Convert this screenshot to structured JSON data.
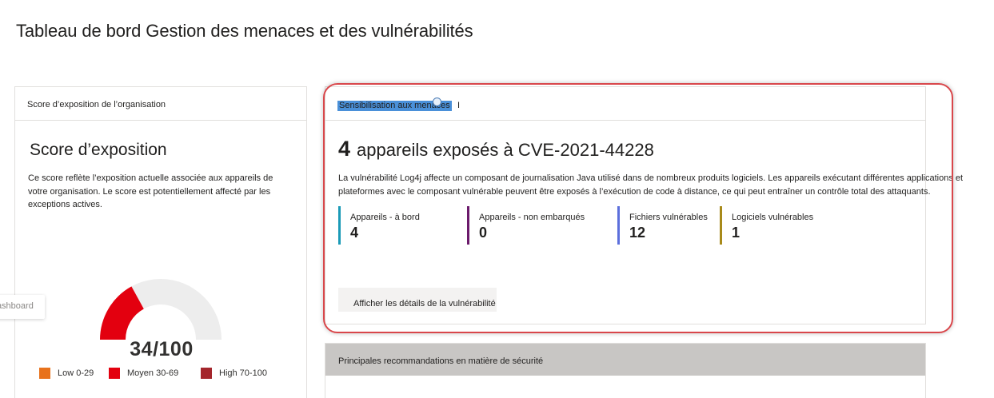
{
  "page": {
    "title": "Tableau de bord Gestion des menaces et des vulnérabilités"
  },
  "exposure_card": {
    "header": "Score d’exposition de l’organisation",
    "title": "Score d’exposition",
    "description": "Ce score reflète l’exposition actuelle associée aux appareils de votre organisation. Le score est potentiellement affecté par les exceptions actives.",
    "score": "34/100",
    "score_value": 34,
    "score_max": 100,
    "legend": [
      {
        "label": "Low 0-29",
        "color": "#e8721c"
      },
      {
        "label": "Moyen 30-69",
        "color": "#e3000f"
      },
      {
        "label": "High 70-100",
        "color": "#a4262c"
      }
    ]
  },
  "tooltip": {
    "text": "Dashboard"
  },
  "threat_card": {
    "header": "Sensibilisation aux menaces",
    "caret": "I",
    "count": "4",
    "title": "appareils exposés à CVE-2021-44228",
    "description": "La vulnérabilité Log4j affecte un composant de journalisation Java utilisé dans de nombreux produits logiciels. Les appareils exécutant différentes applications et plateformes avec le composant vulnérable peuvent être exposés à l’exécution de code à distance, ce qui peut entraîner un contrôle total des attaquants.",
    "stats": [
      {
        "label": "Appareils - à bord",
        "value": "4",
        "color": "#1a9ab7"
      },
      {
        "label": "Appareils - non embarqués",
        "value": "0",
        "color": "#6b1a6b"
      },
      {
        "label": "Fichiers vulnérables",
        "value": "12",
        "color": "#5c6fdc"
      },
      {
        "label": "Logiciels vulnérables",
        "value": "1",
        "color": "#a88a1a"
      }
    ],
    "details_button": "Afficher les détails de la vulnérabilité"
  },
  "recommendations_card": {
    "header": "Principales recommandations en matière de sécurité"
  }
}
